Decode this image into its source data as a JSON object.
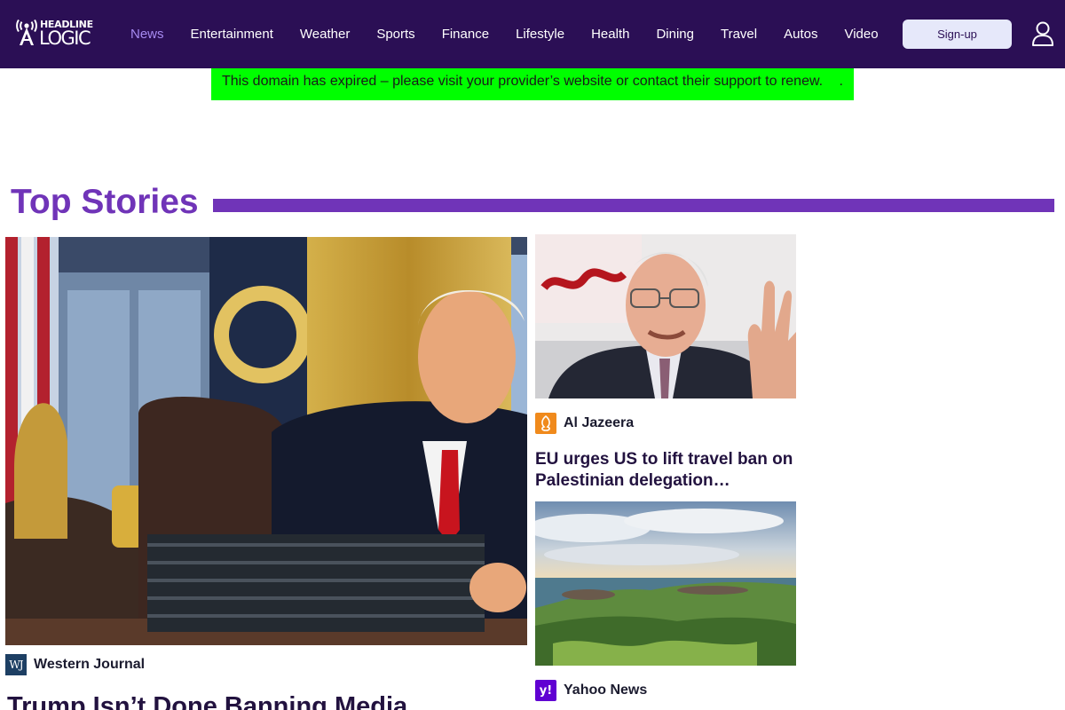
{
  "brand": {
    "logo_top": "HEADLINE",
    "logo_bottom": "LOGIC",
    "color": "#2b0f55",
    "accent": "#7034b8"
  },
  "nav": {
    "items": [
      {
        "label": "News",
        "active": true
      },
      {
        "label": "Entertainment"
      },
      {
        "label": "Weather"
      },
      {
        "label": "Sports"
      },
      {
        "label": "Finance"
      },
      {
        "label": "Lifestyle"
      },
      {
        "label": "Health"
      },
      {
        "label": "Dining"
      },
      {
        "label": "Travel"
      },
      {
        "label": "Autos"
      },
      {
        "label": "Video"
      }
    ],
    "signup_label": "Sign-up",
    "user_icon": "user-icon"
  },
  "banner": {
    "text": "This domain has expired – please visit your provider’s website or contact their support to renew.",
    "trailing": ".",
    "color": "#00ff00"
  },
  "top_stories": {
    "title": "Top Stories",
    "stories": [
      {
        "source": "Western Journal",
        "source_logo": "WJ",
        "headline": "Trump Isn’t Done Banning Media"
      },
      {
        "source": "Al Jazeera",
        "source_logo": "al-jazeera-icon",
        "headline": "EU urges US to lift travel ban on Palestinian delegation…"
      },
      {
        "source": "Yahoo News",
        "source_logo": "y!"
      }
    ]
  }
}
